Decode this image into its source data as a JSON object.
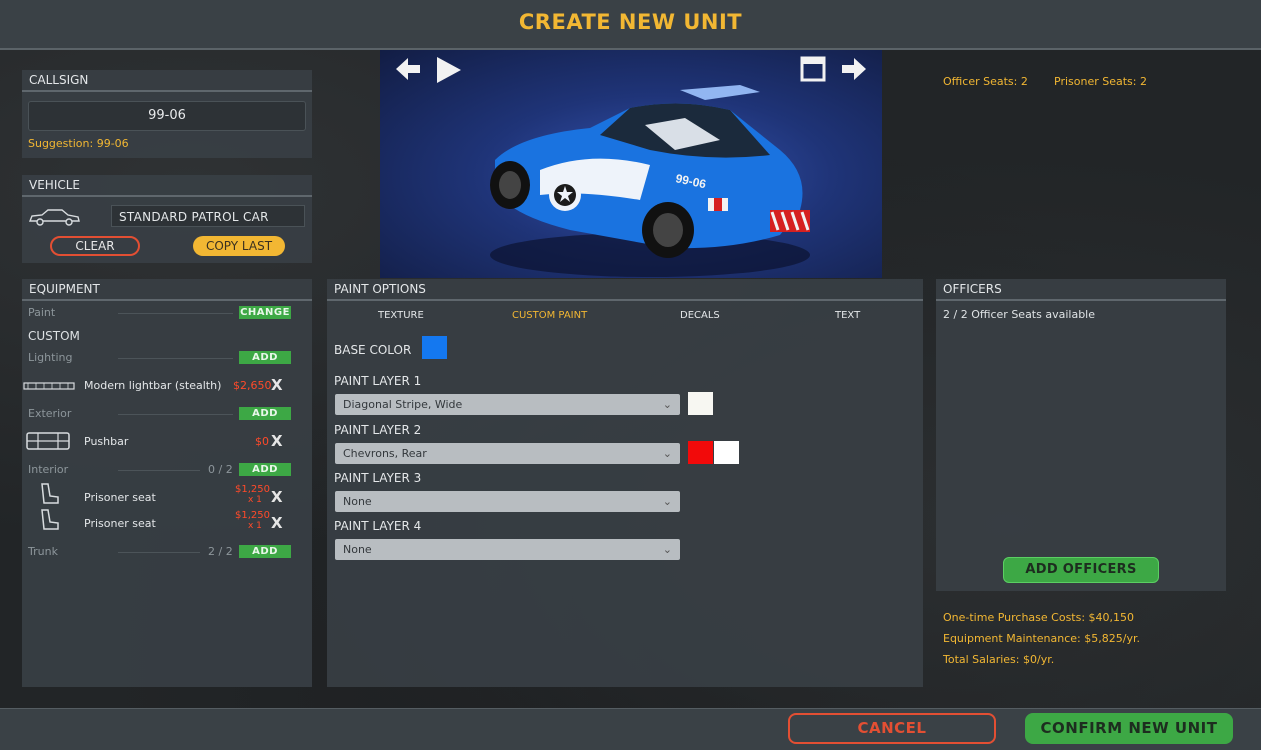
{
  "title": "CREATE NEW UNIT",
  "callsign": {
    "header": "CALLSIGN",
    "value": "99-06",
    "suggestion": "Suggestion: 99-06"
  },
  "vehicle": {
    "header": "VEHICLE",
    "name": "STANDARD PATROL CAR",
    "clear_label": "CLEAR",
    "copy_label": "COPY LAST"
  },
  "preview": {
    "car_number": "99-06"
  },
  "seats": {
    "officer": "Officer Seats: 2",
    "prisoner": "Prisoner Seats: 2"
  },
  "equipment": {
    "header": "EQUIPMENT",
    "paint_label": "Paint",
    "change_label": "CHANGE",
    "custom_label": "CUSTOM",
    "lighting_label": "Lighting",
    "exterior_label": "Exterior",
    "interior_label": "Interior",
    "trunk_label": "Trunk",
    "add_label": "ADD",
    "interior_count": "0 / 2",
    "trunk_count": "2 / 2",
    "lightbar": {
      "name": "Modern lightbar (stealth)",
      "price": "$2,650"
    },
    "pushbar": {
      "name": "Pushbar",
      "price": "$0"
    },
    "seat1": {
      "name": "Prisoner seat",
      "price": "$1,250",
      "sub": "x 1"
    },
    "seat2": {
      "name": "Prisoner seat",
      "price": "$1,250",
      "sub": "x 1"
    },
    "remove": "X"
  },
  "paint": {
    "header": "PAINT OPTIONS",
    "tabs": [
      "TEXTURE",
      "CUSTOM PAINT",
      "DECALS",
      "TEXT"
    ],
    "base_color_label": "BASE COLOR",
    "layers": [
      {
        "label": "PAINT LAYER 1",
        "value": "Diagonal Stripe, Wide"
      },
      {
        "label": "PAINT LAYER 2",
        "value": "Chevrons, Rear"
      },
      {
        "label": "PAINT LAYER 3",
        "value": "None"
      },
      {
        "label": "PAINT LAYER 4",
        "value": "None"
      }
    ],
    "colors": {
      "base": "#1478f0",
      "layer1": "#f7f7f2",
      "layer2a": "#f20a0a",
      "layer2b": "#ffffff"
    }
  },
  "officers": {
    "header": "OFFICERS",
    "available": "2 / 2 Officer Seats available",
    "add_label": "ADD OFFICERS"
  },
  "costs": {
    "purchase": "One-time Purchase Costs: $40,150",
    "maintenance": "Equipment Maintenance: $5,825/yr.",
    "salaries": "Total Salaries: $0/yr."
  },
  "footer": {
    "cancel": "CANCEL",
    "confirm": "CONFIRM NEW UNIT"
  }
}
